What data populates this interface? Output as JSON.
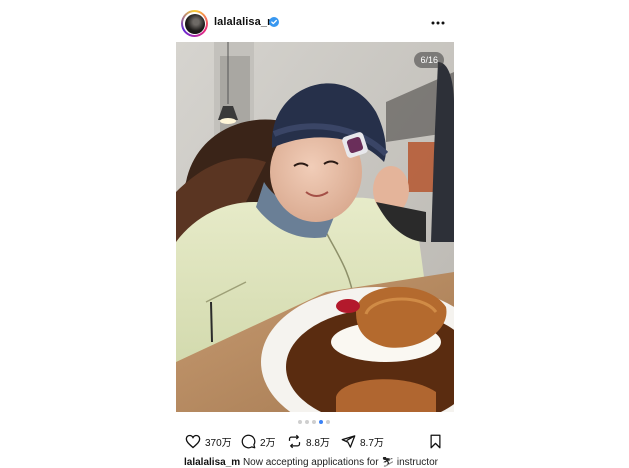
{
  "post": {
    "username": "lalalalisa_m",
    "image_counter": "6/16",
    "carousel": {
      "total_dots": 5,
      "active_index": 3
    },
    "actions": {
      "likes": "370万",
      "comments": "2万",
      "reposts": "8.8万",
      "shares": "8.7万"
    },
    "caption": {
      "username": "lalalalisa_m",
      "text": "Now accepting applications for",
      "emoji": "⛷",
      "text_after": "instructor"
    }
  },
  "icons": {
    "verified": "verified-badge-icon",
    "more": "more-options-icon",
    "like": "heart-icon",
    "comment": "comment-icon",
    "repost": "repost-icon",
    "share": "send-icon",
    "save": "bookmark-icon"
  },
  "colors": {
    "verified_blue": "#3897f0",
    "active_dot": "#3b82f6"
  }
}
